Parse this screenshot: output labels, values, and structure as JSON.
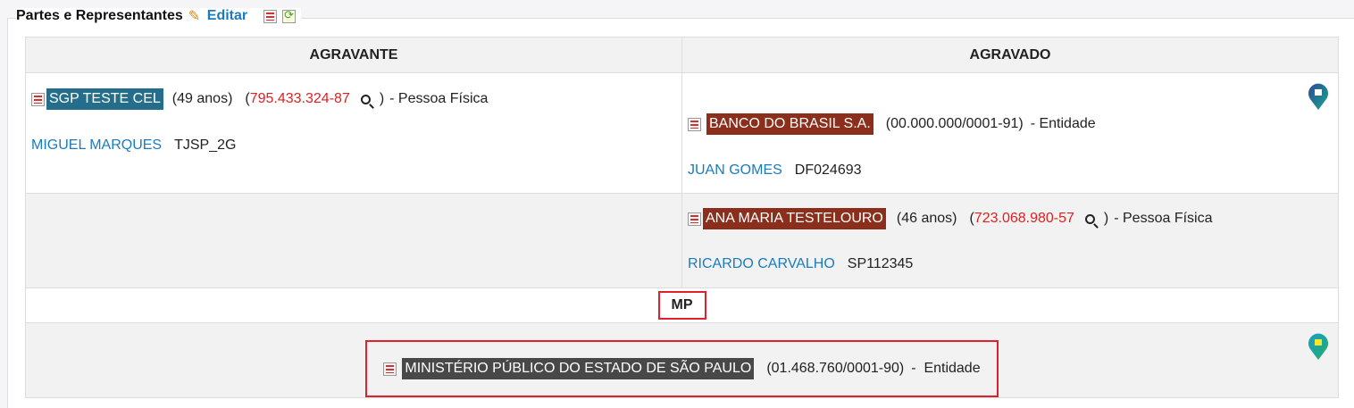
{
  "section": {
    "title": "Partes e Representantes",
    "edit_label": "Editar"
  },
  "columns": [
    "AGRAVANTE",
    "AGRAVADO"
  ],
  "agravante": [
    {
      "name": "SGP TESTE CEL",
      "age": "(49 anos)",
      "doc": "795.433.324-87",
      "type": "- Pessoa Física",
      "rep_name": "MIGUEL MARQUES",
      "rep_id": "TJSP_2G"
    }
  ],
  "agravado": [
    {
      "name": "BANCO DO BRASIL S.A.",
      "doc": "(00.000.000/0001-91)",
      "type": "- Entidade",
      "rep_name": "JUAN GOMES",
      "rep_id": "DF024693"
    },
    {
      "name": "ANA MARIA TESTELOURO",
      "age": "(46 anos)",
      "doc": "723.068.980-57",
      "type": "- Pessoa Física",
      "rep_name": "RICARDO CARVALHO",
      "rep_id": "SP112345"
    }
  ],
  "mp": {
    "header": "MP",
    "name": "MINISTÉRIO PÚBLICO DO ESTADO DE SÃO PAULO",
    "doc": "(01.468.760/0001-90)",
    "type": "-  Entidade"
  },
  "colors": {
    "name_blue": "#246e8c",
    "name_brown": "#8b2e1c",
    "name_dark": "#484848",
    "doc_red": "#e02020",
    "link": "#1a7bbf",
    "highlight_box": "#e0202a"
  }
}
